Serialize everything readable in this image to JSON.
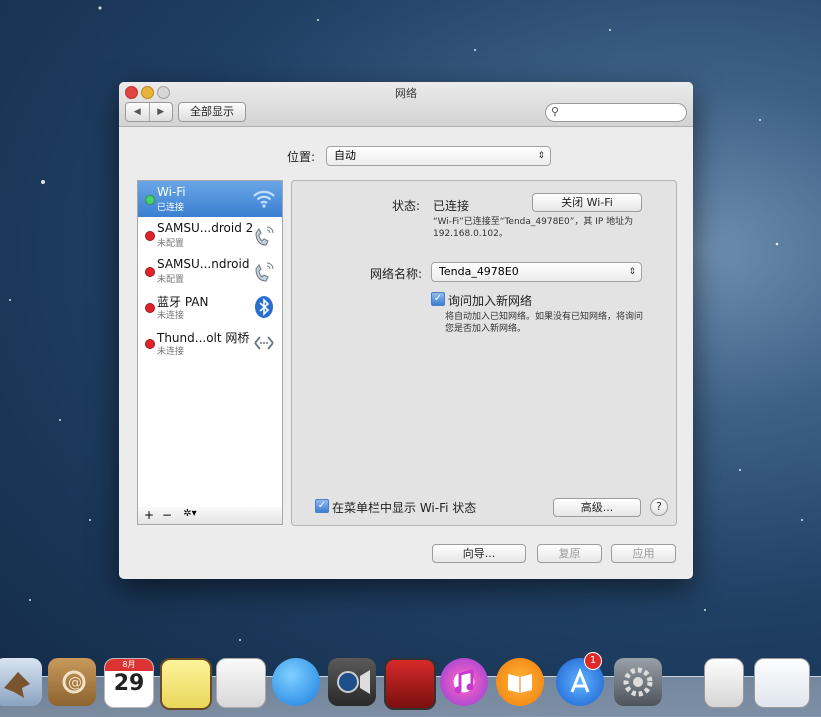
{
  "window": {
    "title": "网络",
    "nav_back": "◀",
    "nav_forward": "▶",
    "show_all": "全部显示",
    "search_placeholder": ""
  },
  "location": {
    "label": "位置:",
    "value": "自动"
  },
  "services": [
    {
      "name": "Wi-Fi",
      "status": "已连接",
      "state": "green",
      "icon": "wifi-icon"
    },
    {
      "name": "SAMSU...droid 2",
      "status": "未配置",
      "state": "red",
      "icon": "phone-icon"
    },
    {
      "name": "SAMSU...ndroid",
      "status": "未配置",
      "state": "red",
      "icon": "phone-icon"
    },
    {
      "name": "蓝牙 PAN",
      "status": "未连接",
      "state": "red",
      "icon": "bluetooth-icon"
    },
    {
      "name": "Thund...olt 网桥",
      "status": "未连接",
      "state": "red",
      "icon": "bridge-icon"
    }
  ],
  "sidebar_tools": {
    "add": "+",
    "remove": "−",
    "gear": "✲▾"
  },
  "detail": {
    "status_label": "状态:",
    "status_value": "已连接",
    "turn_off_button": "关闭 Wi-Fi",
    "status_desc_1": "“Wi-Fi”已连接至“Tenda_4978E0”，其 IP 地址为",
    "status_desc_2": "192.168.0.102。",
    "network_name_label": "网络名称:",
    "network_name_value": "Tenda_4978E0",
    "ask_join_label": "询问加入新网络",
    "ask_join_checked": true,
    "ask_join_desc_1": "将自动加入已知网络。如果没有已知网络，将询问",
    "ask_join_desc_2": "您是否加入新网络。",
    "show_menubar_label": "在菜单栏中显示 Wi-Fi 状态",
    "advanced_button": "高级...",
    "help": "?"
  },
  "footer": {
    "assist": "向导...",
    "revert": "复原",
    "apply": "应用"
  },
  "dock": {
    "calendar_month": "8月",
    "calendar_day": "29",
    "appstore_badge": "1",
    "items": [
      "mail-icon",
      "contacts-icon",
      "calendar-icon",
      "notes-icon",
      "reminders-icon",
      "messages-icon",
      "facetime-icon",
      "photobooth-icon",
      "itunes-icon",
      "ibooks-icon",
      "appstore-icon",
      "system-preferences-icon",
      "preview-icon",
      "finder-document-icon"
    ]
  }
}
